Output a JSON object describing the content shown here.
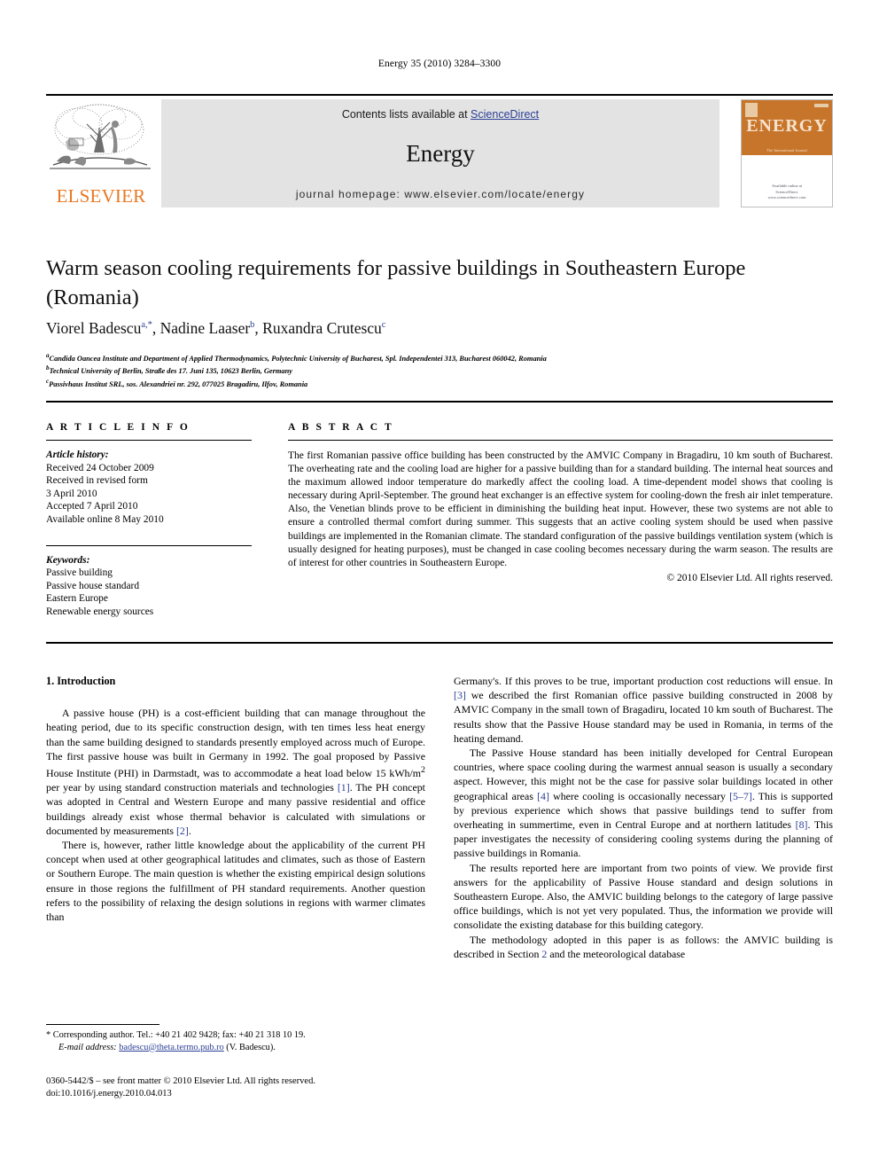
{
  "running_head": "Energy 35 (2010) 3284–3300",
  "journal_header": {
    "contents_prefix": "Contents lists available at ",
    "sciencedirect": "ScienceDirect",
    "journal_title": "Energy",
    "homepage": "journal homepage: www.elsevier.com/locate/energy",
    "publisher_logo_text": "ELSEVIER",
    "cover": {
      "title": "ENERGY",
      "subtitle": "The International Journal",
      "footer_line1": "Available online at",
      "footer_line2": "ScienceDirect",
      "footer_line3": "www.sciencedirect.com"
    },
    "accent_color": "#2b3f95",
    "band_color": "#e3e3e3",
    "elsevier_orange": "#e87722",
    "cover_orange": "#c8752c"
  },
  "article": {
    "title": "Warm season cooling requirements for passive buildings in Southeastern Europe (Romania)",
    "authors_html": "Viorel Badescu<sup>a,*</sup>, Nadine Laaser<sup>b</sup>, Ruxandra Crutescu<sup>c</sup>",
    "affiliations": [
      "Candida Oancea Institute and Department of Applied Thermodynamics, Polytechnic University of Bucharest, Spl. Independentei 313, Bucharest 060042, Romania",
      "Technical University of Berlin, Straße des 17. Juni 135, 10623 Berlin, Germany",
      "Passivhaus Institut SRL, sos. Alexandriei nr. 292, 077025 Bragadiru, Ilfov, Romania"
    ],
    "affiliation_marks": [
      "a",
      "b",
      "c"
    ]
  },
  "article_info": {
    "heading": "A R T I C L E   I N F O",
    "history_label": "Article history:",
    "history": [
      "Received 24 October 2009",
      "Received in revised form",
      "3 April 2010",
      "Accepted 7 April 2010",
      "Available online 8 May 2010"
    ],
    "keywords_label": "Keywords:",
    "keywords": [
      "Passive building",
      "Passive house standard",
      "Eastern Europe",
      "Renewable energy sources"
    ]
  },
  "abstract": {
    "heading": "A B S T R A C T",
    "text": "The first Romanian passive office building has been constructed by the AMVIC Company in Bragadiru, 10 km south of Bucharest. The overheating rate and the cooling load are higher for a passive building than for a standard building. The internal heat sources and the maximum allowed indoor temperature do markedly affect the cooling load. A time-dependent model shows that cooling is necessary during April-September. The ground heat exchanger is an effective system for cooling-down the fresh air inlet temperature. Also, the Venetian blinds prove to be efficient in diminishing the building heat input. However, these two systems are not able to ensure a controlled thermal comfort during summer. This suggests that an active cooling system should be used when passive buildings are implemented in the Romanian climate. The standard configuration of the passive buildings ventilation system (which is usually designed for heating purposes), must be changed in case cooling becomes necessary during the warm season. The results are of interest for other countries in Southeastern Europe.",
    "copyright": "© 2010 Elsevier Ltd. All rights reserved."
  },
  "body": {
    "section_heading": "1. Introduction",
    "left_paragraphs": [
      "A passive house (PH) is a cost-efficient building that can manage throughout the heating period, due to its specific construction design, with ten times less heat energy than the same building designed to standards presently employed across much of Europe. The first passive house was built in Germany in 1992. The goal proposed by Passive House Institute (PHI) in Darmstadt, was to accommodate a heat load below 15 kWh/m2 per year by using standard construction materials and technologies [1]. The PH concept was adopted in Central and Western Europe and many passive residential and office buildings already exist whose thermal behavior is calculated with simulations or documented by measurements [2].",
      "There is, however, rather little knowledge about the applicability of the current PH concept when used at other geographical latitudes and climates, such as those of Eastern or Southern Europe. The main question is whether the existing empirical design solutions ensure in those regions the fulfillment of PH standard requirements. Another question refers to the possibility of relaxing the design solutions in regions with warmer climates than"
    ],
    "right_paragraphs": [
      "Germany's. If this proves to be true, important production cost reductions will ensue. In [3] we described the first Romanian office passive building constructed in 2008 by AMVIC Company in the small town of Bragadiru, located 10 km south of Bucharest. The results show that the Passive House standard may be used in Romania, in terms of the heating demand.",
      "The Passive House standard has been initially developed for Central European countries, where space cooling during the warmest annual season is usually a secondary aspect. However, this might not be the case for passive solar buildings located in other geographical areas [4] where cooling is occasionally necessary [5–7]. This is supported by previous experience which shows that passive buildings tend to suffer from overheating in summertime, even in Central Europe and at northern latitudes [8]. This paper investigates the necessity of considering cooling systems during the planning of passive buildings in Romania.",
      "The results reported here are important from two points of view. We provide first answers for the applicability of Passive House standard and design solutions in Southeastern Europe. Also, the AMVIC building belongs to the category of large passive office buildings, which is not yet very populated. Thus, the information we provide will consolidate the existing database for this building category.",
      "The methodology adopted in this paper is as follows: the AMVIC building is described in Section 2 and the meteorological database"
    ],
    "inline_refs": [
      "[1]",
      "[2]",
      "[3]",
      "[4]",
      "[5–7]",
      "[8]",
      "2"
    ],
    "heat_load_value": "15 kWh/m",
    "heat_load_exponent": "2"
  },
  "footnote": {
    "corresponding": "* Corresponding author. Tel.: +40 21 402 9428; fax: +40 21 318 10 19.",
    "email_label": "E-mail address:",
    "email": "badescu@theta.termo.pub.ro",
    "email_owner": "(V. Badescu)."
  },
  "imprint": {
    "line1": "0360-5442/$ – see front matter © 2010 Elsevier Ltd. All rights reserved.",
    "line2": "doi:10.1016/j.energy.2010.04.013"
  }
}
